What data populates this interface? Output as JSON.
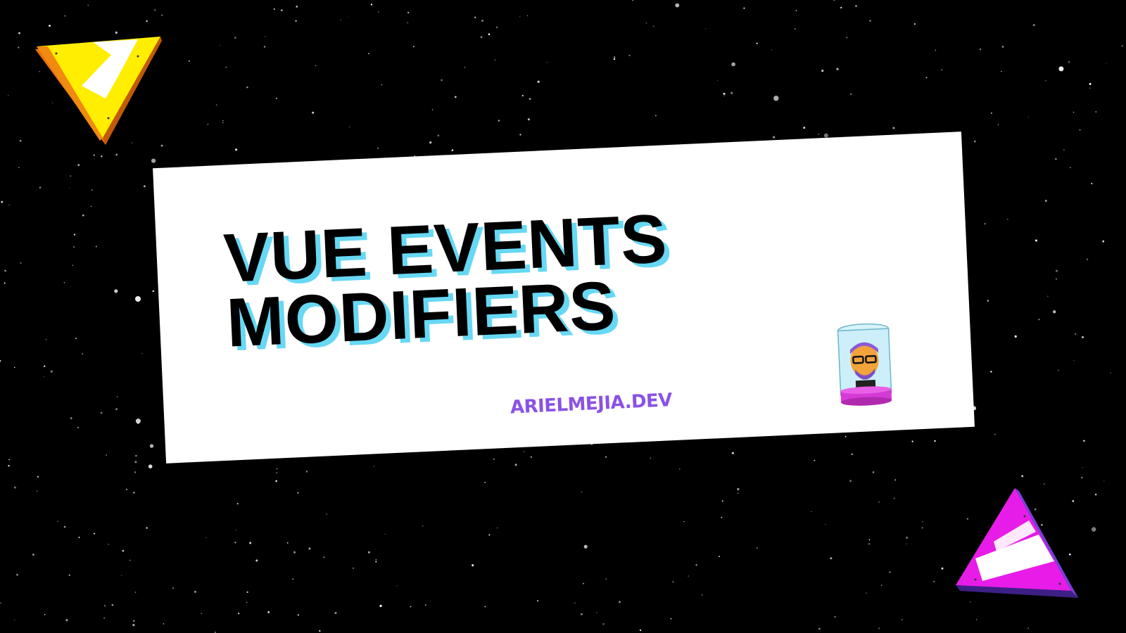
{
  "slide": {
    "title_line1": "VUE EVENTS",
    "title_line2": "MODIFIERS",
    "website": "ARIELMEJIA.DEV",
    "avatar_label": "ARIEL MEJIA DEV"
  },
  "decorations": {
    "top_left": "yellow-triangle-icon",
    "bottom_right": "magenta-triangle-icon",
    "background": "starfield"
  },
  "colors": {
    "background": "#000000",
    "banner": "#ffffff",
    "title_text": "#000000",
    "title_shadow": "#67d8f4",
    "website_text": "#8a52e6",
    "triangle_yellow": "#ffee00",
    "triangle_orange": "#f08a10",
    "triangle_magenta": "#e81ce8",
    "triangle_purple": "#7a3fd6"
  }
}
